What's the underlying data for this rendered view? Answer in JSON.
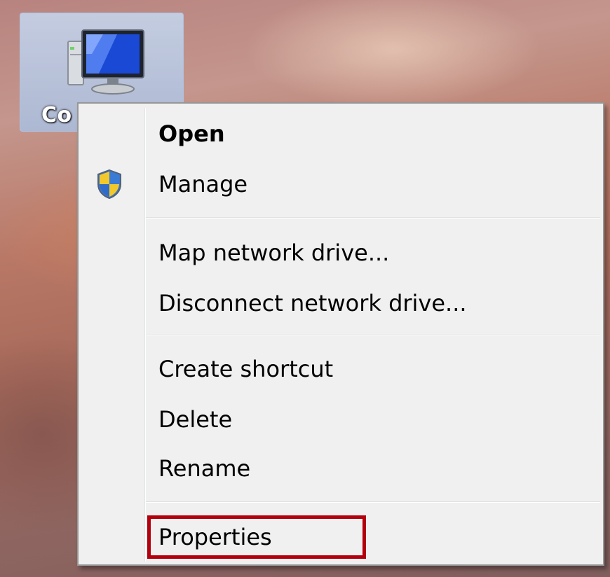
{
  "desktop": {
    "icon": {
      "label": "Co",
      "icon_name": "computer-icon"
    }
  },
  "context_menu": {
    "items": [
      {
        "label": "Open",
        "default": true
      },
      {
        "label": "Manage",
        "icon_name": "uac-shield-icon"
      },
      {
        "label": "Map network drive..."
      },
      {
        "label": "Disconnect network drive..."
      },
      {
        "label": "Create shortcut"
      },
      {
        "label": "Delete"
      },
      {
        "label": "Rename"
      },
      {
        "label": "Properties",
        "highlighted": true
      }
    ]
  },
  "colors": {
    "menu_background": "#f0f0f0",
    "menu_border": "#979797",
    "highlight_border": "#b3000c",
    "selection_fill": "#c4d2e8"
  }
}
